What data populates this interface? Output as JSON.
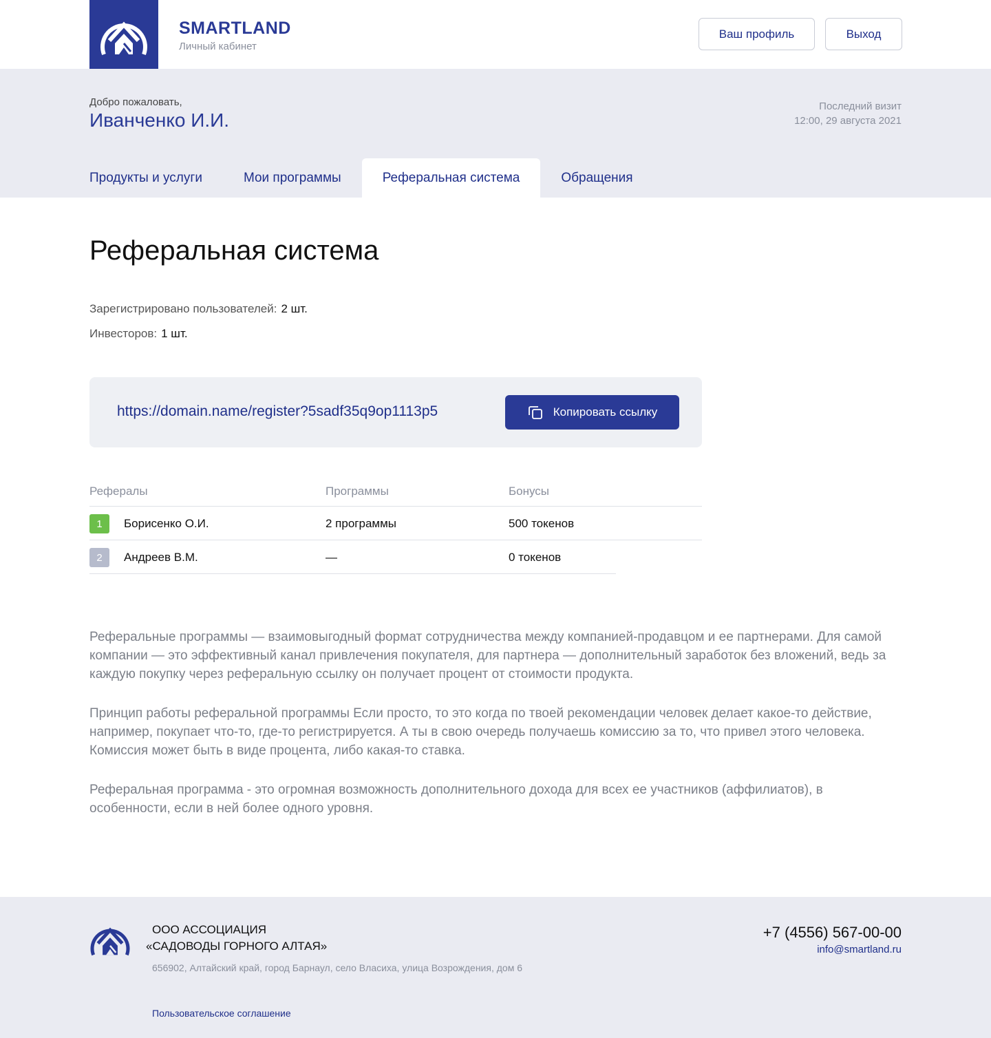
{
  "header": {
    "brand_name": "SMARTLAND",
    "brand_subtitle": "Личный кабинет",
    "profile_button": "Ваш профиль",
    "logout_button": "Выход",
    "brand_color": "#2a3a96"
  },
  "welcome": {
    "greeting": "Добро пожаловать,",
    "user_name": "Иванченко И.И.",
    "last_visit_label": "Последний визит",
    "last_visit_value": "12:00, 29 августа 2021"
  },
  "tabs": [
    {
      "label": "Продукты и услуги",
      "active": false
    },
    {
      "label": "Мои программы",
      "active": false
    },
    {
      "label": "Реферальная система",
      "active": true
    },
    {
      "label": "Обращения",
      "active": false
    }
  ],
  "main": {
    "title": "Реферальная система",
    "stats": [
      {
        "label": "Зарегистрировано пользователей:",
        "value": "2 шт."
      },
      {
        "label": "Инвесторов:",
        "value": "1 шт."
      }
    ],
    "referral_link": "https://domain.name/register?5sadf35q9op1113p5",
    "copy_button": "Копировать ссылку"
  },
  "table": {
    "headers": [
      "Рефералы",
      "Программы",
      "Бонусы"
    ],
    "rows": [
      {
        "num": "1",
        "name": "Борисенко О.И.",
        "programs": "2 программы",
        "bonus": "500 токенов",
        "badge_color": "#6cbf4a"
      },
      {
        "num": "2",
        "name": "Андреев В.М.",
        "programs": "—",
        "bonus": "0 токенов",
        "badge_color": "#b6bbcc"
      }
    ]
  },
  "description": [
    "Реферальные программы — взаимовыгодный формат сотрудничества между компанией-продавцом и ее партнерами. Для самой компании — это эффективный канал привлечения покупателя, для партнера — дополнительный заработок без вложений, ведь за каждую покупку через реферальную ссылку он получает процент от стоимости продукта.",
    "Принцип работы реферальной программы Если просто, то это когда по твоей рекомендации человек делает какое-то действие, например, покупает что-то, где-то регистрируется. А ты в свою очередь получаешь комиссию за то, что привел этого человека. Комиссия может быть в виде процента, либо какая-то ставка.",
    "Реферальная программа - это огромная возможность дополнительного дохода для всех ее участников (аффилиатов), в особенности, если в ней более одного уровня."
  ],
  "footer": {
    "org_line1": "ООО АССОЦИАЦИЯ",
    "org_line2": "«САДОВОДЫ ГОРНОГО АЛТАЯ»",
    "address": "656902, Алтайский край, город Барнаул, село Власиха, улица Возрождения, дом 6",
    "agreement": "Пользовательское соглашение",
    "phone": "+7 (4556) 567-00-00",
    "email": "info@smartland.ru"
  }
}
